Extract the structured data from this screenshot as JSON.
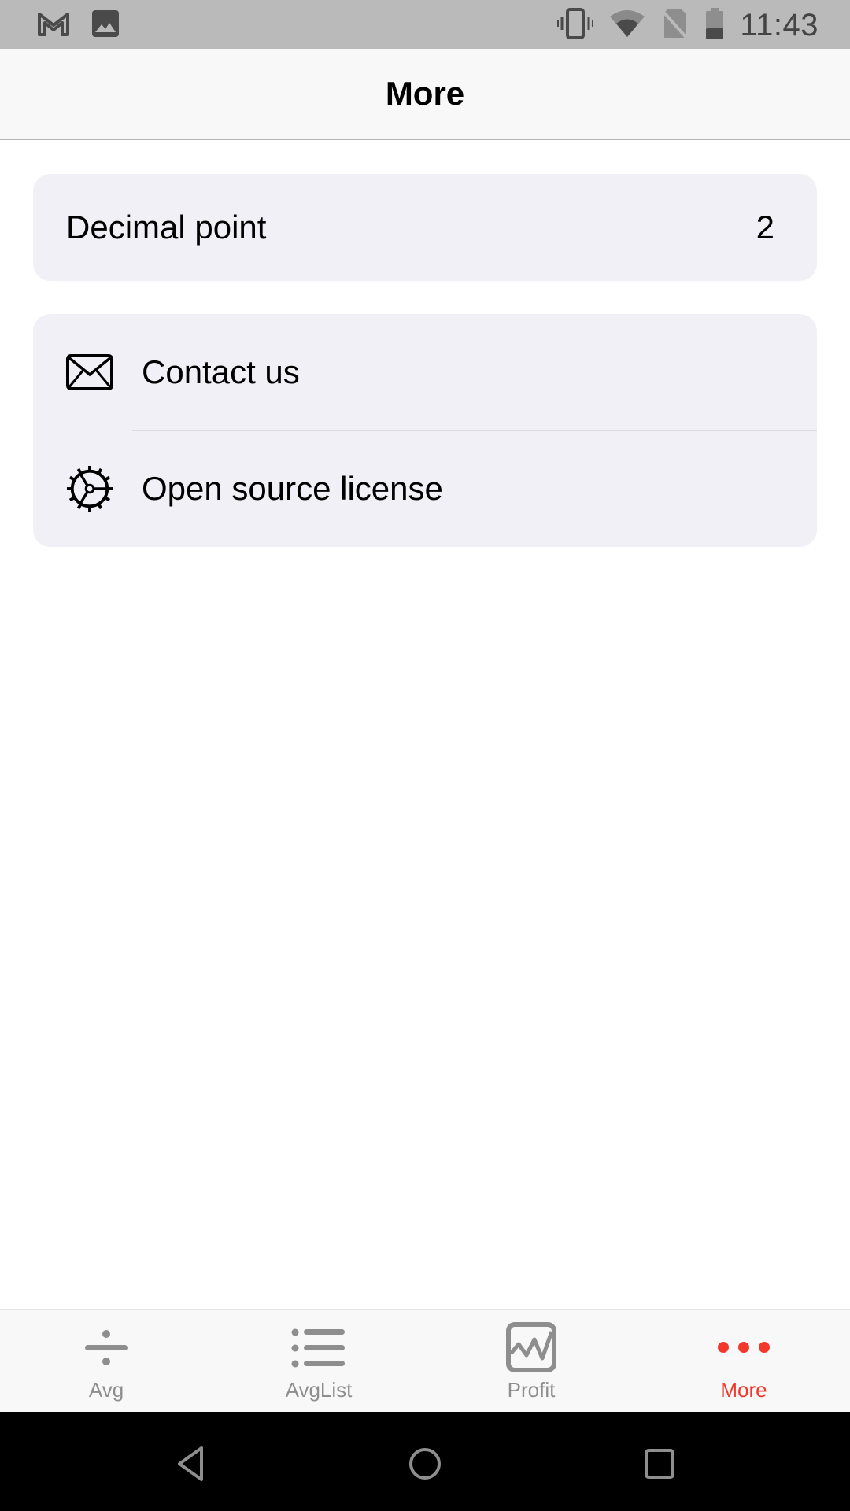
{
  "status_bar": {
    "left_icons": [
      "gmail-icon",
      "image-icon"
    ],
    "right_icons": [
      "vibrate-icon",
      "wifi-icon",
      "no-sim-icon",
      "battery-icon"
    ],
    "time": "11:43"
  },
  "header": {
    "title": "More"
  },
  "settings": {
    "decimal_point": {
      "label": "Decimal point",
      "value": "2"
    },
    "links": [
      {
        "label": "Contact us",
        "icon": "envelope-icon"
      },
      {
        "label": "Open source license",
        "icon": "gear-icon"
      }
    ]
  },
  "tabbar": {
    "active_color": "#f2372c",
    "inactive_color": "#8e8e8e",
    "tabs": [
      {
        "label": "Avg",
        "icon": "divide-icon",
        "active": false
      },
      {
        "label": "AvgList",
        "icon": "list-icon",
        "active": false
      },
      {
        "label": "Profit",
        "icon": "chart-icon",
        "active": false
      },
      {
        "label": "More",
        "icon": "more-dots-icon",
        "active": true
      }
    ]
  },
  "navbar": {
    "buttons": [
      "back-icon",
      "home-icon",
      "recents-icon"
    ]
  }
}
